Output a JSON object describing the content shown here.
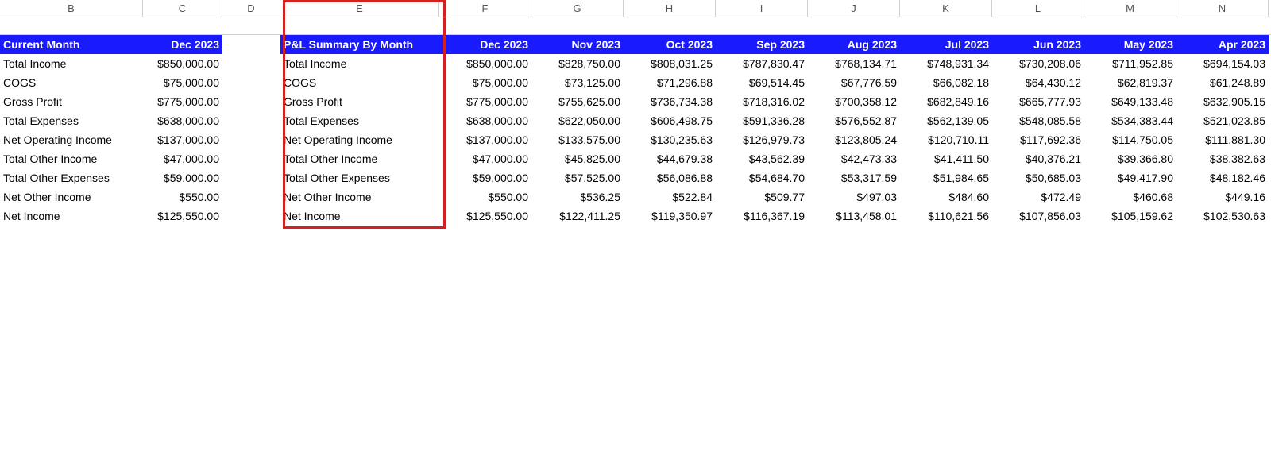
{
  "columns": [
    "B",
    "C",
    "D",
    "E",
    "F",
    "G",
    "H",
    "I",
    "J",
    "K",
    "L",
    "M",
    "N"
  ],
  "left_block": {
    "header_label": "Current Month",
    "header_value": "Dec 2023",
    "rows": [
      {
        "label": "Total Income",
        "value": "$850,000.00"
      },
      {
        "label": "COGS",
        "value": "$75,000.00"
      },
      {
        "label": "Gross Profit",
        "value": "$775,000.00"
      },
      {
        "label": "Total Expenses",
        "value": "$638,000.00"
      },
      {
        "label": "Net Operating Income",
        "value": "$137,000.00"
      },
      {
        "label": "Total Other Income",
        "value": "$47,000.00"
      },
      {
        "label": "Total Other Expenses",
        "value": "$59,000.00"
      },
      {
        "label": "Net Other Income",
        "value": "$550.00"
      },
      {
        "label": "Net Income",
        "value": "$125,550.00"
      }
    ]
  },
  "right_block": {
    "header_label": "P&L Summary By Month",
    "months": [
      "Dec 2023",
      "Nov 2023",
      "Oct 2023",
      "Sep 2023",
      "Aug 2023",
      "Jul 2023",
      "Jun 2023",
      "May 2023",
      "Apr 2023"
    ],
    "rows": [
      {
        "label": "Total Income",
        "values": [
          "$850,000.00",
          "$828,750.00",
          "$808,031.25",
          "$787,830.47",
          "$768,134.71",
          "$748,931.34",
          "$730,208.06",
          "$711,952.85",
          "$694,154.03"
        ]
      },
      {
        "label": "COGS",
        "values": [
          "$75,000.00",
          "$73,125.00",
          "$71,296.88",
          "$69,514.45",
          "$67,776.59",
          "$66,082.18",
          "$64,430.12",
          "$62,819.37",
          "$61,248.89"
        ]
      },
      {
        "label": "Gross Profit",
        "values": [
          "$775,000.00",
          "$755,625.00",
          "$736,734.38",
          "$718,316.02",
          "$700,358.12",
          "$682,849.16",
          "$665,777.93",
          "$649,133.48",
          "$632,905.15"
        ]
      },
      {
        "label": "Total Expenses",
        "values": [
          "$638,000.00",
          "$622,050.00",
          "$606,498.75",
          "$591,336.28",
          "$576,552.87",
          "$562,139.05",
          "$548,085.58",
          "$534,383.44",
          "$521,023.85"
        ]
      },
      {
        "label": "Net Operating Income",
        "values": [
          "$137,000.00",
          "$133,575.00",
          "$130,235.63",
          "$126,979.73",
          "$123,805.24",
          "$120,710.11",
          "$117,692.36",
          "$114,750.05",
          "$111,881.30"
        ]
      },
      {
        "label": "Total Other Income",
        "values": [
          "$47,000.00",
          "$45,825.00",
          "$44,679.38",
          "$43,562.39",
          "$42,473.33",
          "$41,411.50",
          "$40,376.21",
          "$39,366.80",
          "$38,382.63"
        ]
      },
      {
        "label": "Total Other Expenses",
        "values": [
          "$59,000.00",
          "$57,525.00",
          "$56,086.88",
          "$54,684.70",
          "$53,317.59",
          "$51,984.65",
          "$50,685.03",
          "$49,417.90",
          "$48,182.46"
        ]
      },
      {
        "label": "Net Other Income",
        "values": [
          "$550.00",
          "$536.25",
          "$522.84",
          "$509.77",
          "$497.03",
          "$484.60",
          "$472.49",
          "$460.68",
          "$449.16"
        ]
      },
      {
        "label": "Net Income",
        "values": [
          "$125,550.00",
          "$122,411.25",
          "$119,350.97",
          "$116,367.19",
          "$113,458.01",
          "$110,621.56",
          "$107,856.03",
          "$105,159.62",
          "$102,530.63"
        ]
      }
    ]
  },
  "chart_data": {
    "type": "table",
    "title": "P&L Summary By Month",
    "categories": [
      "Dec 2023",
      "Nov 2023",
      "Oct 2023",
      "Sep 2023",
      "Aug 2023",
      "Jul 2023",
      "Jun 2023",
      "May 2023",
      "Apr 2023"
    ],
    "series": [
      {
        "name": "Total Income",
        "values": [
          850000.0,
          828750.0,
          808031.25,
          787830.47,
          768134.71,
          748931.34,
          730208.06,
          711952.85,
          694154.03
        ]
      },
      {
        "name": "COGS",
        "values": [
          75000.0,
          73125.0,
          71296.88,
          69514.45,
          67776.59,
          66082.18,
          64430.12,
          62819.37,
          61248.89
        ]
      },
      {
        "name": "Gross Profit",
        "values": [
          775000.0,
          755625.0,
          736734.38,
          718316.02,
          700358.12,
          682849.16,
          665777.93,
          649133.48,
          632905.15
        ]
      },
      {
        "name": "Total Expenses",
        "values": [
          638000.0,
          622050.0,
          606498.75,
          591336.28,
          576552.87,
          562139.05,
          548085.58,
          534383.44,
          521023.85
        ]
      },
      {
        "name": "Net Operating Income",
        "values": [
          137000.0,
          133575.0,
          130235.63,
          126979.73,
          123805.24,
          120710.11,
          117692.36,
          114750.05,
          111881.3
        ]
      },
      {
        "name": "Total Other Income",
        "values": [
          47000.0,
          45825.0,
          44679.38,
          43562.39,
          42473.33,
          41411.5,
          40376.21,
          39366.8,
          38382.63
        ]
      },
      {
        "name": "Total Other Expenses",
        "values": [
          59000.0,
          57525.0,
          56086.88,
          54684.7,
          53317.59,
          51984.65,
          50685.03,
          49417.9,
          48182.46
        ]
      },
      {
        "name": "Net Other Income",
        "values": [
          550.0,
          536.25,
          522.84,
          509.77,
          497.03,
          484.6,
          472.49,
          460.68,
          449.16
        ]
      },
      {
        "name": "Net Income",
        "values": [
          125550.0,
          122411.25,
          119350.97,
          116367.19,
          113458.01,
          110621.56,
          107856.03,
          105159.62,
          102530.63
        ]
      }
    ]
  }
}
